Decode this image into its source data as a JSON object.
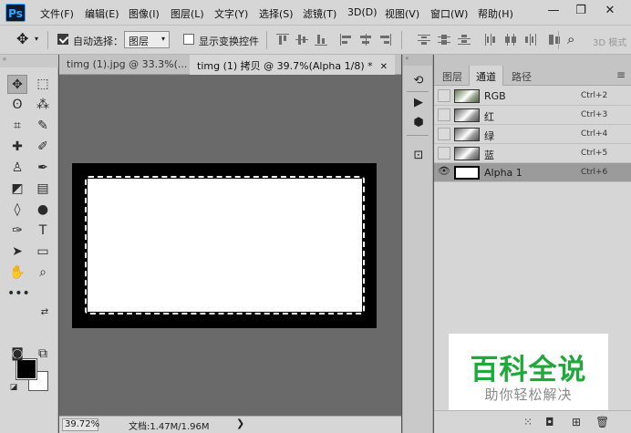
{
  "app": {
    "logo": "Ps"
  },
  "menu": [
    "文件(F)",
    "编辑(E)",
    "图像(I)",
    "图层(L)",
    "文字(Y)",
    "选择(S)",
    "滤镜(T)",
    "3D(D)",
    "视图(V)",
    "窗口(W)",
    "帮助(H)"
  ],
  "window_controls": {
    "minimize": "—",
    "restore": "❐",
    "close": "✕"
  },
  "options": {
    "auto_select_label": "自动选择：",
    "auto_select_checked": true,
    "auto_select_value": "图层",
    "show_transform_label": "显示变换控件",
    "show_transform_checked": false,
    "mode_3d_label": "3D 模式"
  },
  "tabs": [
    {
      "label": "timg (1).jpg @ 33.3%(...",
      "active": false
    },
    {
      "label": "timg (1) 拷贝 @ 39.7%(Alpha 1/8) *",
      "active": true
    }
  ],
  "status": {
    "zoom": "39.72%",
    "doc": "文档:1.47M/1.96M",
    "arrow": "❯"
  },
  "panel": {
    "tabs": [
      "图层",
      "通道",
      "路径"
    ],
    "active_tab": "通道",
    "channels": [
      {
        "name": "RGB",
        "shortcut": "Ctrl+2",
        "visible": false,
        "selected": false,
        "thumb": "color"
      },
      {
        "name": "红",
        "shortcut": "Ctrl+3",
        "visible": false,
        "selected": false,
        "thumb": "gray"
      },
      {
        "name": "绿",
        "shortcut": "Ctrl+4",
        "visible": false,
        "selected": false,
        "thumb": "gray"
      },
      {
        "name": "蓝",
        "shortcut": "Ctrl+5",
        "visible": false,
        "selected": false,
        "thumb": "gray"
      },
      {
        "name": "Alpha 1",
        "shortcut": "Ctrl+6",
        "visible": true,
        "selected": true,
        "thumb": "alpha"
      }
    ]
  },
  "watermark": {
    "title": "百科全说",
    "subtitle": "助你轻松解决"
  },
  "colors": {
    "foreground": "#000000",
    "background": "#ffffff",
    "watermark_green": "#21a83b"
  }
}
